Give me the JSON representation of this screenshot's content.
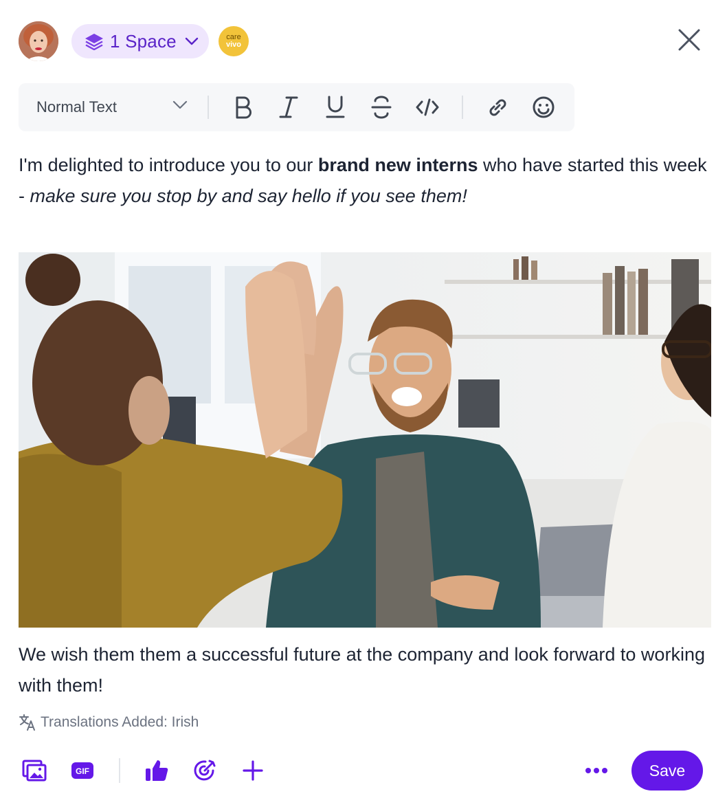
{
  "header": {
    "avatar_alt": "user avatar",
    "space_label": "1 Space",
    "brand_logo_line1": "care",
    "brand_logo_line2": "vivo"
  },
  "toolbar": {
    "text_style": "Normal Text",
    "buttons": [
      "bold",
      "italic",
      "underline",
      "strikethrough",
      "code",
      "link",
      "emoji"
    ]
  },
  "content": {
    "para1_start": "I'm delighted to introduce you to our ",
    "para1_bold": "brand new interns",
    "para1_mid": " who have started this week - ",
    "para1_italic": "make sure you stop by and say hello if you see them!",
    "para2": "We wish them them a successful future at the company and look forward to working with them!",
    "translations": "Translations Added: Irish"
  },
  "footer": {
    "save_label": "Save"
  },
  "colors": {
    "accent": "#6418e8",
    "pill_bg": "#efe6fd",
    "brand_yellow": "#f2c33a"
  }
}
